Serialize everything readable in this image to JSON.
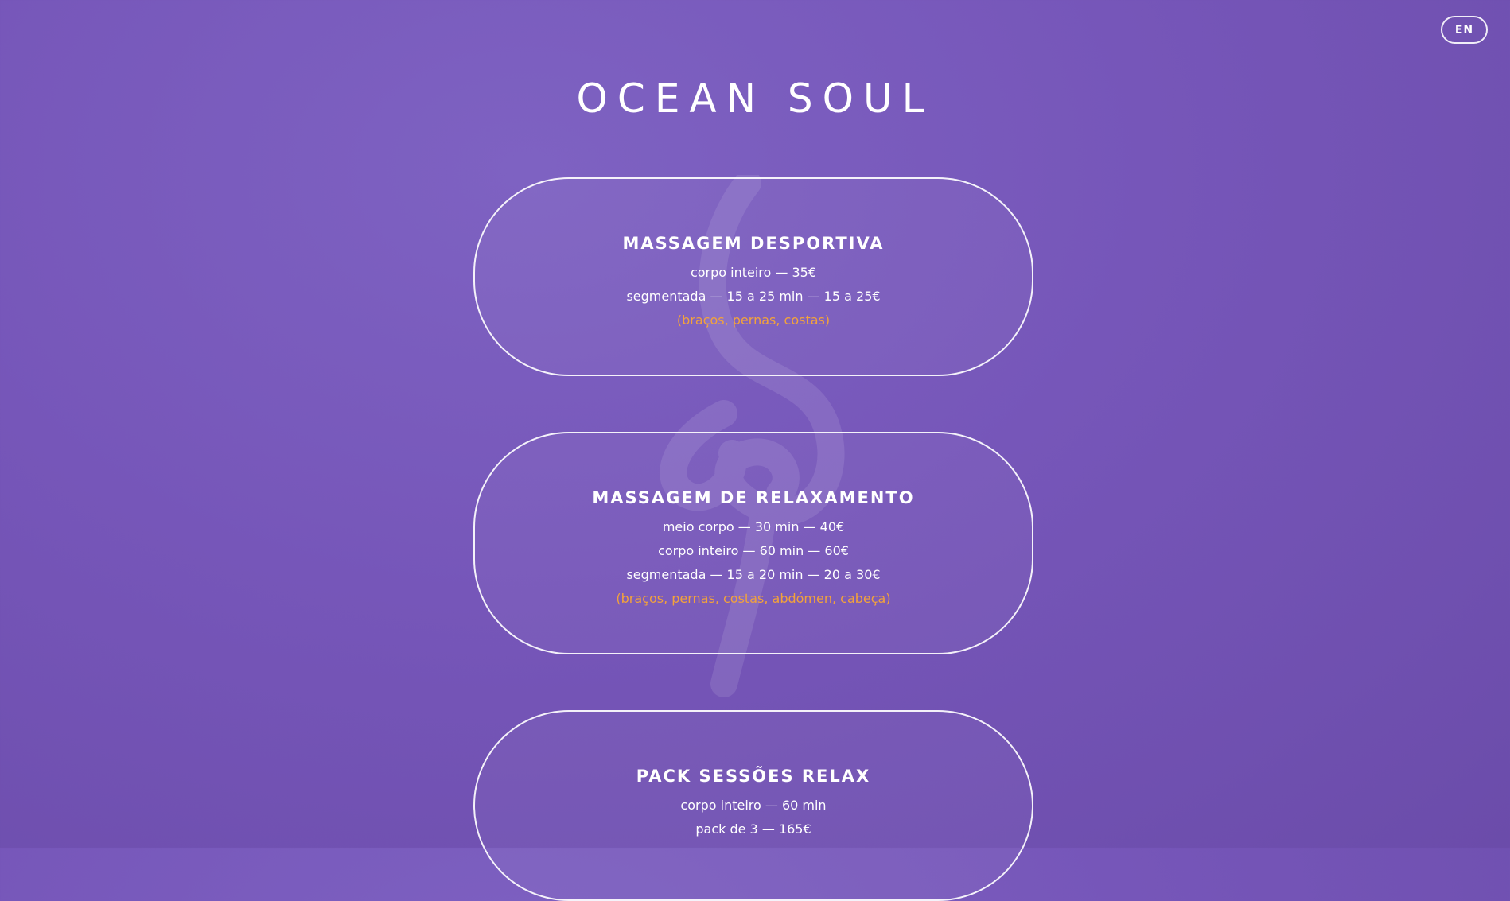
{
  "lang_switch": {
    "label": "EN"
  },
  "header": {
    "title": "OCEAN SOUL"
  },
  "services": [
    {
      "title": "MASSAGEM DESPORTIVA",
      "lines": [
        "corpo inteiro — 35€",
        "segmentada — 15 a 25 min — 15 a 25€"
      ],
      "note": "(braços, pernas, costas)"
    },
    {
      "title": "MASSAGEM DE RELAXAMENTO",
      "lines": [
        "meio corpo — 30 min — 40€",
        "corpo inteiro — 60 min — 60€",
        "segmentada — 15 a 20 min — 20 a 30€"
      ],
      "note": "(braços, pernas, costas, abdómen, cabeça)"
    },
    {
      "title": "PACK SESSÕES RELAX",
      "lines": [
        "corpo inteiro — 60 min",
        "pack de 3 — 165€"
      ]
    }
  ],
  "colors": {
    "background": "#7656b9",
    "accent_note": "#f2a23c",
    "text": "#ffffff"
  }
}
